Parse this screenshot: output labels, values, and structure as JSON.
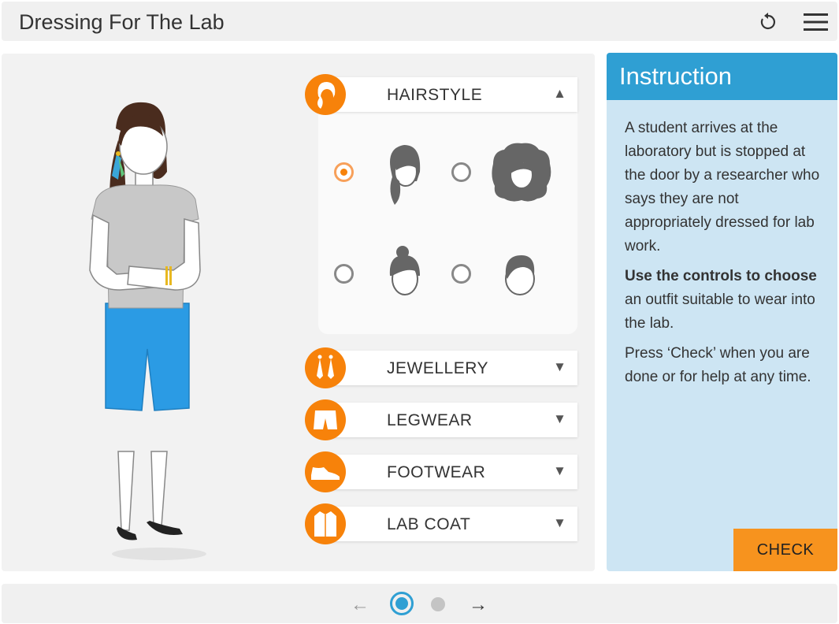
{
  "header": {
    "title": "Dressing For The Lab",
    "reset_icon": "reset-icon",
    "menu_icon": "hamburger-menu-icon"
  },
  "accordion": [
    {
      "label": "HAIRSTYLE",
      "icon": "hairstyle-icon",
      "arrow": "▲",
      "expanded": true
    },
    {
      "label": "JEWELLERY",
      "icon": "earrings-icon",
      "arrow": "▼",
      "expanded": false
    },
    {
      "label": "LEGWEAR",
      "icon": "shorts-icon",
      "arrow": "▼",
      "expanded": false
    },
    {
      "label": "FOOTWEAR",
      "icon": "shoe-icon",
      "arrow": "▼",
      "expanded": false
    },
    {
      "label": "LAB COAT",
      "icon": "lab-coat-icon",
      "arrow": "▼",
      "expanded": false
    }
  ],
  "hairstyles": [
    {
      "icon": "long-ponytail-hair-icon",
      "selected": true
    },
    {
      "icon": "curly-afro-hair-icon",
      "selected": false
    },
    {
      "icon": "bun-hair-icon",
      "selected": false
    },
    {
      "icon": "short-hair-icon",
      "selected": false
    }
  ],
  "instruction": {
    "title": "Instruction",
    "para1": "A student arrives at the laboratory but is stopped at the door by a researcher who says they are not appropriately dressed for lab work.",
    "para2_bold": "Use the controls to choose",
    "para2_rest": " an outfit suitable to wear into the lab.",
    "para3": "Press ‘Check’ when you are done or for help at any time.",
    "check_label": "CHECK"
  },
  "pager": {
    "prev": "←",
    "next": "→",
    "current_page": 1,
    "total_pages": 2
  },
  "colors": {
    "accent_orange": "#f7820a",
    "accent_blue": "#2f9fd3",
    "panel_bg": "#cde5f3",
    "shorts_blue": "#2b9be4"
  }
}
